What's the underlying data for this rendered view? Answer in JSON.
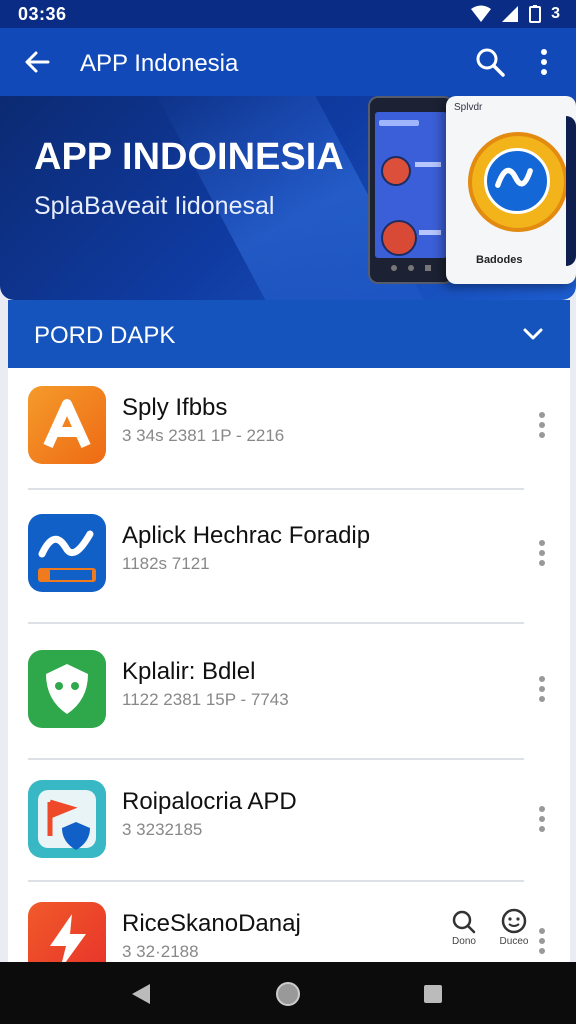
{
  "status_bar": {
    "time": "03:36",
    "battery_text": "3"
  },
  "app_bar": {
    "title": "APP Indonesia"
  },
  "hero": {
    "title": "APP INDOINESIA",
    "subtitle": "SplaBaveait Iidonesal",
    "card_top_label": "Splvdr",
    "card_bottom_label": "Badodes"
  },
  "section": {
    "header": "PORD DAPK"
  },
  "apps": [
    {
      "name": "Sply Ifbbs",
      "meta": "3 34s 2381 1P - 2216",
      "icon": "orange-a-icon",
      "color": "#f07a1e"
    },
    {
      "name": "Aplick Hechrac Foradip",
      "meta": "1182s 7121",
      "icon": "blue-wave-icon",
      "color": "#1060c8"
    },
    {
      "name": "Kplalir: Bdlel",
      "meta": "1122 2381 15P - 7743",
      "icon": "green-shield-icon",
      "color": "#2ea84a"
    },
    {
      "name": "Roipalocria APD",
      "meta": "3 3232185",
      "icon": "teal-flag-icon",
      "color": "#37b8c4"
    },
    {
      "name": "RiceSkanoDanaj",
      "meta": "3 32·2188",
      "icon": "red-bolt-icon",
      "color": "#ee4a2a"
    }
  ],
  "mini_actions": [
    {
      "label": "Dono",
      "icon": "search-icon"
    },
    {
      "label": "Duceo",
      "icon": "smiley-icon"
    }
  ],
  "colors": {
    "primary": "#1553bd",
    "dark": "#0a2c85"
  }
}
